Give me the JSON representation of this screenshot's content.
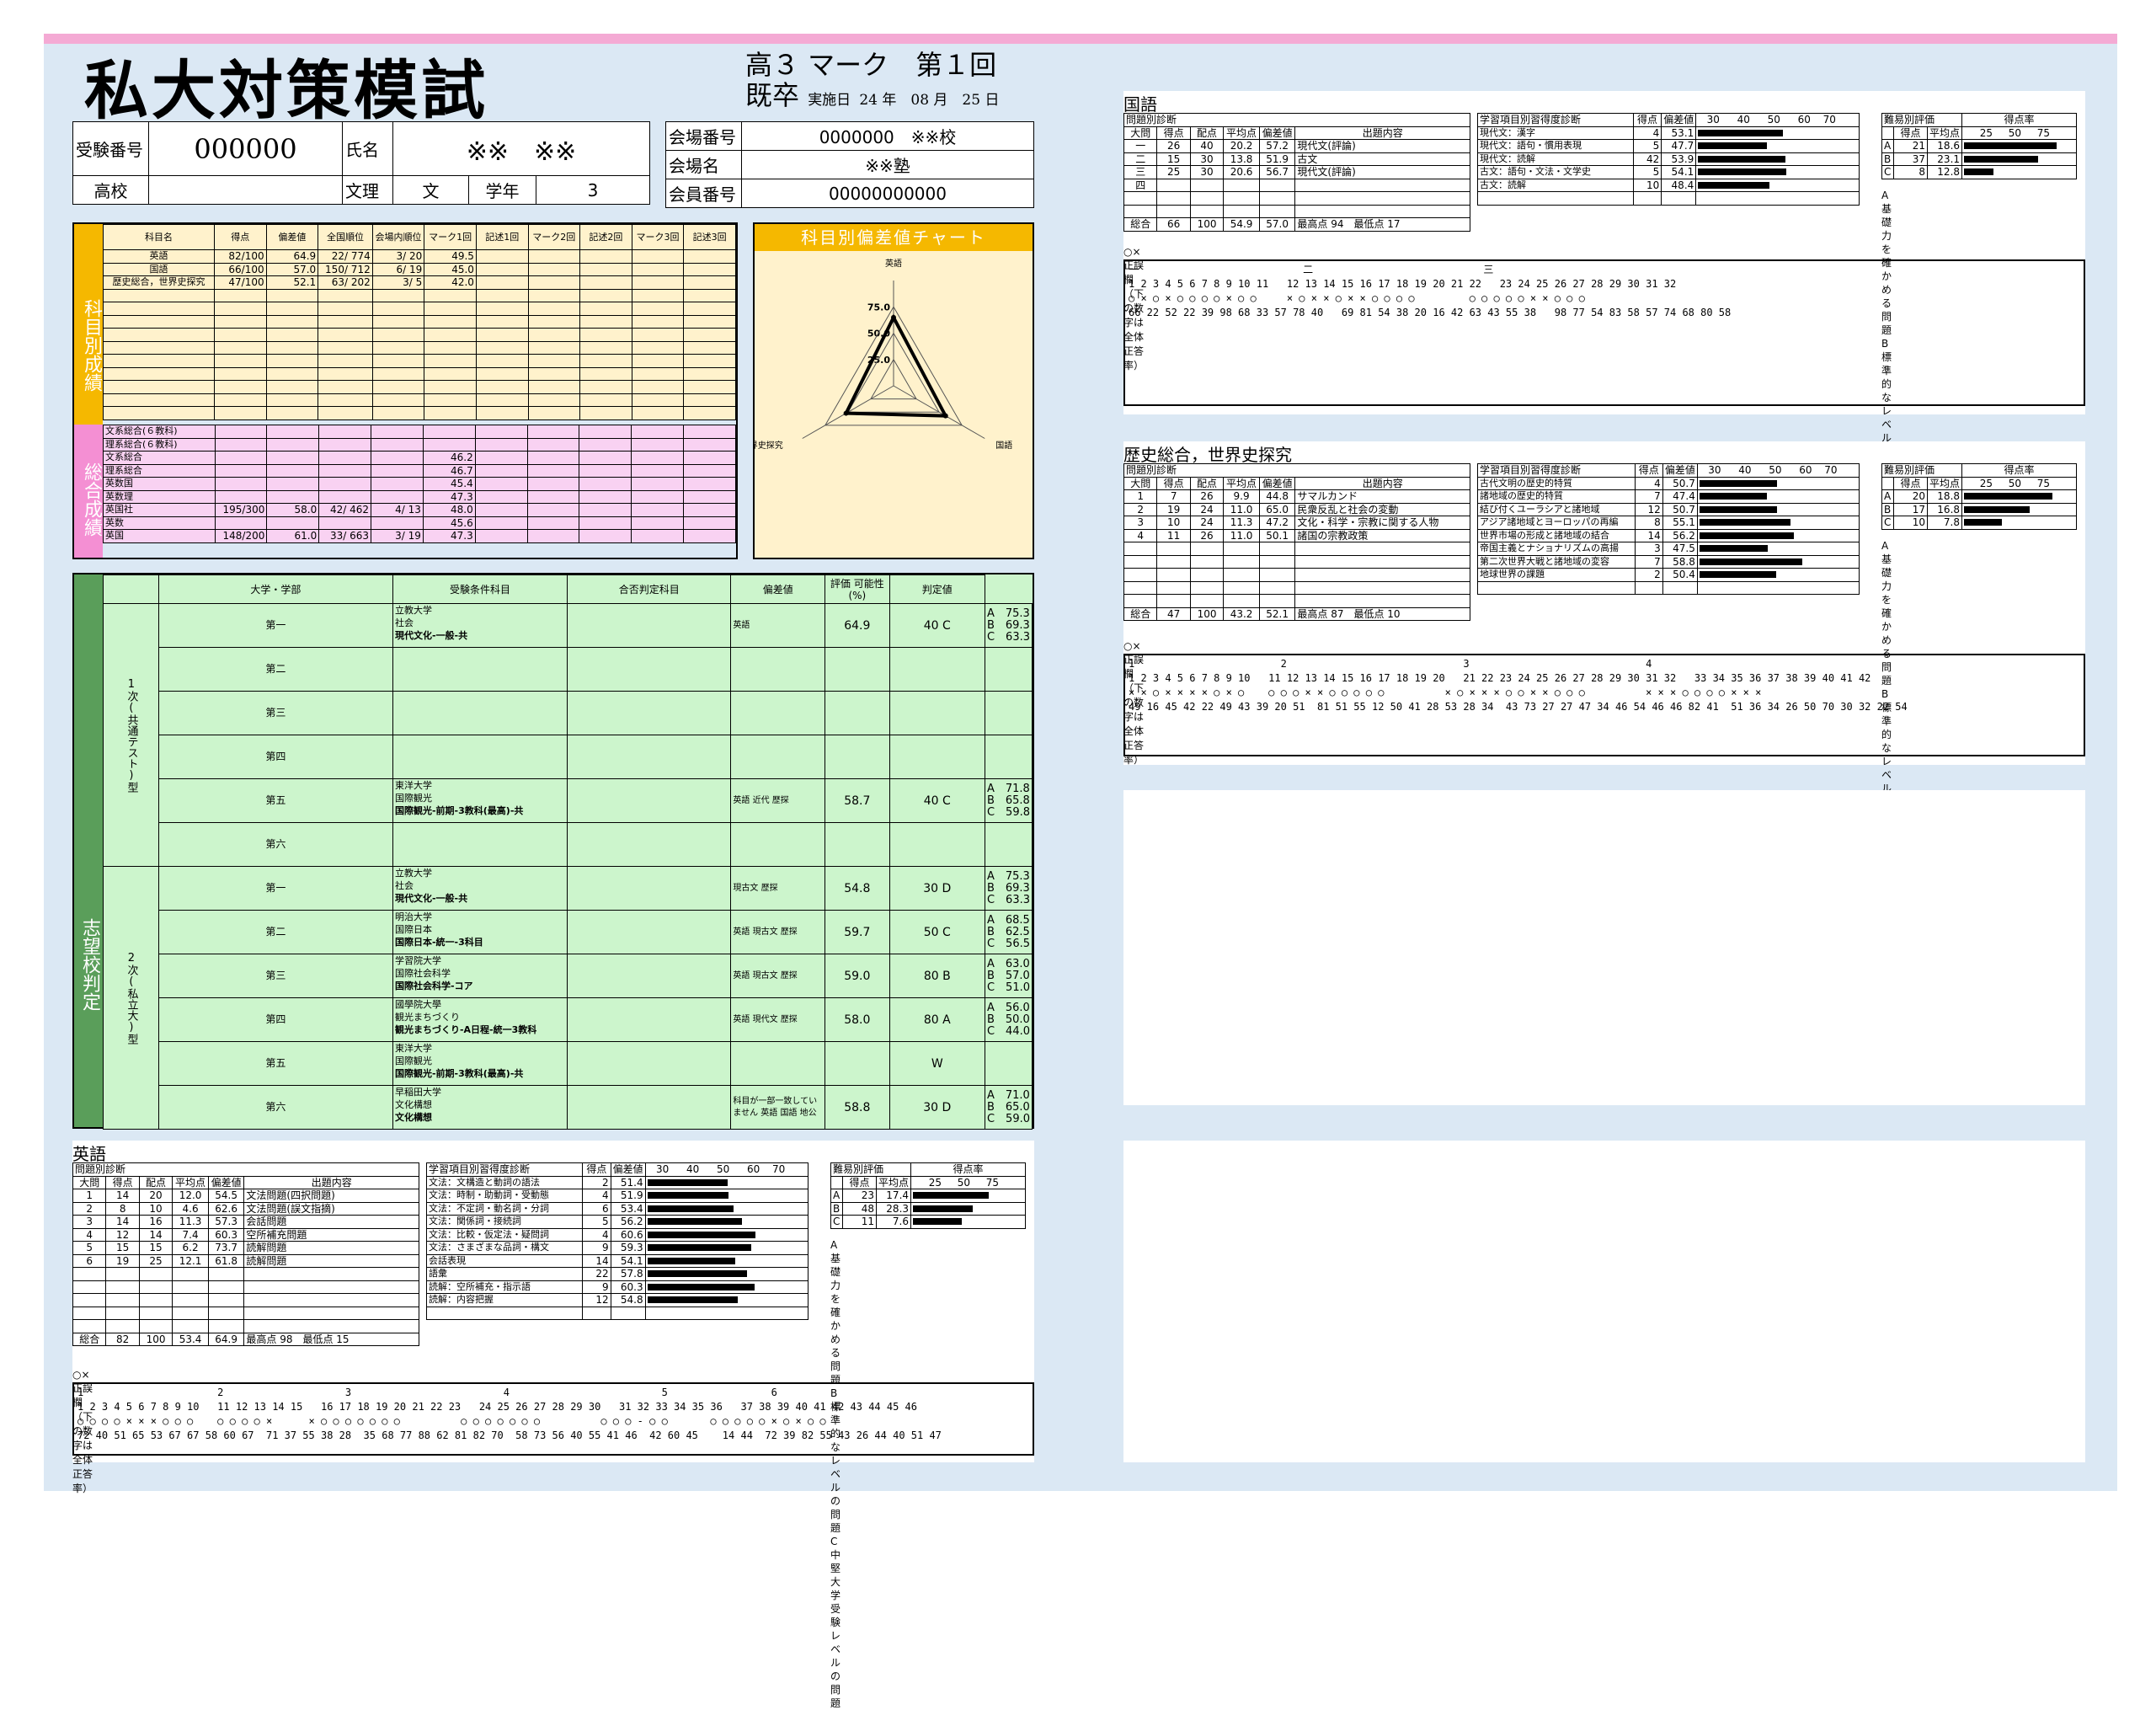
{
  "header": {
    "title": "私大対策模試",
    "exam_line": "高３ マーク　第１回",
    "grade": "既卒",
    "date_label": "実施日",
    "date": "24 年　08 月　25 日"
  },
  "info": {
    "exam_no_label": "受験番号",
    "exam_no": "000000",
    "name_label": "氏名",
    "name": "※※　※※",
    "school_label": "高校",
    "school": "",
    "bunri_label": "文理",
    "bunri": "文",
    "year_label": "学年",
    "year": "3",
    "venue_no_label": "会場番号",
    "venue_no": "0000000　※※校",
    "venue_label": "会場名",
    "venue": "※※塾",
    "member_label": "会員番号",
    "member": "00000000000"
  },
  "subjects": {
    "side_label": "科目別成績",
    "headers": [
      "科目名",
      "得点",
      "偏差値",
      "全国順位",
      "会場内順位",
      "マーク1回",
      "記述1回",
      "マーク2回",
      "記述2回",
      "マーク3回",
      "記述3回"
    ],
    "rows": [
      [
        "英語",
        "82/100",
        "64.9",
        "22/ 774",
        "3/ 20",
        "49.5"
      ],
      [
        "国語",
        "66/100",
        "57.0",
        "150/ 712",
        "6/ 19",
        "45.0"
      ],
      [
        "歴史総合，世界史探究",
        "47/100",
        "52.1",
        "63/ 202",
        "3/ 5",
        "42.0"
      ]
    ],
    "total_label": "総合成績",
    "total_rows": [
      [
        "文系総合(６教科)",
        "",
        "",
        "",
        "",
        ""
      ],
      [
        "理系総合(６教科)",
        "",
        "",
        "",
        "",
        ""
      ],
      [
        "文系総合",
        "",
        "",
        "",
        "",
        "46.2"
      ],
      [
        "理系総合",
        "",
        "",
        "",
        "",
        "46.7"
      ],
      [
        "英数国",
        "",
        "",
        "",
        "",
        "45.4"
      ],
      [
        "英数理",
        "",
        "",
        "",
        "",
        "47.3"
      ],
      [
        "英国社",
        "195/300",
        "58.0",
        "42/ 462",
        "4/ 13",
        "48.0"
      ],
      [
        "英数",
        "",
        "",
        "",
        "",
        "45.6"
      ],
      [
        "英国",
        "148/200",
        "61.0",
        "33/ 663",
        "3/ 19",
        "47.3"
      ]
    ]
  },
  "chart_data": {
    "type": "radar",
    "title": "科目別偏差値チャート",
    "axes": [
      "英語",
      "国語",
      "歴史総合，世界史探究"
    ],
    "ticks": [
      25.0,
      50.0,
      75.0
    ],
    "values": [
      64.9,
      57.0,
      52.1
    ]
  },
  "judge": {
    "side_label": "志望校判定",
    "headers": [
      "大学・学部",
      "受験条件科目",
      "合否判定科目",
      "偏差値",
      "評価 可能性(%)",
      "判定値"
    ],
    "first_label": "1次(共通テスト)型",
    "second_label": "2次(私立大)型",
    "first": [
      {
        "no": "第一",
        "univ": "立教大学",
        "fac": "社会",
        "course": "現代文化-一般-共",
        "cond": "",
        "subj": "英語",
        "dev": "64.9",
        "eval": "40 C",
        "lv": [
          "A　75.3",
          "B　69.3",
          "C　63.3"
        ]
      },
      {
        "no": "第二"
      },
      {
        "no": "第三"
      },
      {
        "no": "第四"
      },
      {
        "no": "第五",
        "univ": "東洋大学",
        "fac": "国際観光",
        "course": "国際観光-前期-3教科(最高)-共",
        "cond": "",
        "subj": "英語 近代 歴探",
        "dev": "58.7",
        "eval": "40 C",
        "lv": [
          "A　71.8",
          "B　65.8",
          "C　59.8"
        ]
      },
      {
        "no": "第六"
      }
    ],
    "second": [
      {
        "no": "第一",
        "univ": "立教大学",
        "fac": "社会",
        "course": "現代文化-一般-共",
        "cond": "",
        "subj": "現古文 歴探",
        "dev": "54.8",
        "eval": "30 D",
        "lv": [
          "A　75.3",
          "B　69.3",
          "C　63.3"
        ]
      },
      {
        "no": "第二",
        "univ": "明治大学",
        "fac": "国際日本",
        "course": "国際日本-統一-3科目",
        "cond": "",
        "subj": "英語 現古文 歴探",
        "dev": "59.7",
        "eval": "50 C",
        "lv": [
          "A　68.5",
          "B　62.5",
          "C　56.5"
        ]
      },
      {
        "no": "第三",
        "univ": "学習院大学",
        "fac": "国際社会科学",
        "course": "国際社会科学-コア",
        "cond": "",
        "subj": "英語 現古文 歴探",
        "dev": "59.0",
        "eval": "80 B",
        "lv": [
          "A　63.0",
          "B　57.0",
          "C　51.0"
        ]
      },
      {
        "no": "第四",
        "univ": "國學院大學",
        "fac": "観光まちづくり",
        "course": "観光まちづくり-A日程-統一3教科",
        "cond": "",
        "subj": "英語 現代文 歴探",
        "dev": "58.0",
        "eval": "80 A",
        "lv": [
          "A　56.0",
          "B　50.0",
          "C　44.0"
        ]
      },
      {
        "no": "第五",
        "univ": "東洋大学",
        "fac": "国際観光",
        "course": "国際観光-前期-3教科(最高)-共",
        "cond": "",
        "subj": "",
        "dev": "",
        "eval": "W",
        "lv": [
          "",
          "",
          ""
        ]
      },
      {
        "no": "第六",
        "univ": "早稲田大学",
        "fac": "文化構想",
        "course": "文化構想",
        "cond": "",
        "subj": "科目が一部一致していません 英語 国語 地公",
        "dev": "58.8",
        "eval": "30 D",
        "lv": [
          "A　71.0",
          "B　65.0",
          "C　59.0"
        ]
      }
    ]
  },
  "labels": {
    "q_diag": "問題別診断",
    "q_cols": [
      "大問",
      "得点",
      "配点",
      "平均点",
      "偏差値",
      "出題内容"
    ],
    "total": "総合",
    "max": "最高点",
    "min": "最低点",
    "item_diag": "学習項目別習得度診断",
    "item_cols": [
      "得点",
      "偏差値"
    ],
    "scale": [
      "30",
      "40",
      "50",
      "60",
      "70"
    ],
    "diff": "難易別評価",
    "rate": "得点率",
    "diff_cols": [
      "得点",
      "平均点"
    ],
    "rate_scale": [
      "25",
      "50",
      "75"
    ],
    "legend": [
      "A 基礎力を確かめる問題",
      "B 標準的なレベルの問題",
      "C 中堅大学受験レベルの問題"
    ],
    "ans_title": "○×正誤欄（下の数字は全体正答率）"
  },
  "sec_en": {
    "title": "英語",
    "q": [
      [
        "1",
        "14",
        "20",
        "12.0",
        "54.5",
        "文法問題(四択問題)"
      ],
      [
        "2",
        "8",
        "10",
        "4.6",
        "62.6",
        "文法問題(誤文指摘)"
      ],
      [
        "3",
        "14",
        "16",
        "11.3",
        "57.3",
        "会話問題"
      ],
      [
        "4",
        "12",
        "14",
        "7.4",
        "60.3",
        "空所補充問題"
      ],
      [
        "5",
        "15",
        "15",
        "6.2",
        "73.7",
        "読解問題"
      ],
      [
        "6",
        "19",
        "25",
        "12.1",
        "61.8",
        "読解問題"
      ]
    ],
    "sum": [
      "82",
      "100",
      "53.4",
      "64.9",
      "98",
      "15"
    ],
    "items": [
      [
        "文法：文構造と動詞の語法",
        "2",
        "51.4"
      ],
      [
        "文法：時制・助動詞・受動態",
        "4",
        "51.9"
      ],
      [
        "文法：不定詞・動名詞・分詞",
        "6",
        "53.4"
      ],
      [
        "文法：関係詞・接続詞",
        "5",
        "56.2"
      ],
      [
        "文法：比較・仮定法・疑問詞",
        "4",
        "60.6"
      ],
      [
        "文法：さまざまな品詞・構文",
        "9",
        "59.3"
      ],
      [
        "会話表現",
        "14",
        "54.1"
      ],
      [
        "語彙",
        "22",
        "57.8"
      ],
      [
        "読解：空所補充・指示語",
        "9",
        "60.3"
      ],
      [
        "読解：内容把握",
        "12",
        "54.8"
      ]
    ],
    "diff": [
      [
        "A",
        "23",
        "17.4",
        "72"
      ],
      [
        "B",
        "48",
        "28.3",
        "57"
      ],
      [
        "C",
        "11",
        "7.6",
        "46"
      ]
    ],
    "ans": [
      "1                      2                    3                         4                         5                 6",
      "1 2 3 4 5 6 7 8 9 10   11 12 13 14 15   16 17 18 19 20 21 22 23   24 25 26 27 28 29 30   31 32 33 34 35 36   37 38 39 40 41 42 43 44 45 46",
      "○ ○ ○ ○ × × × ○ ○ ○    ○ ○ ○ ○ ×      × ○ ○ ○ ○ ○ ○ ○          ○ ○ ○ ○ ○ ○ ○          ○ ○ ○ ‐ ○ ○       ○ ○ ○ ○ ○ × ○ × ○ ○",
      "72 40 51 65 53 67 67 58 60 67  71 37 55 38 28  35 68 77 88 62 81 82 70  58 73 56 40 55 41 46  42 60 45    14 44  72 39 82 55 43 26 44 40 51 47"
    ]
  },
  "sec_jp": {
    "title": "国語",
    "q": [
      [
        "一",
        "26",
        "40",
        "20.2",
        "57.2",
        "現代文(評論)"
      ],
      [
        "二",
        "15",
        "30",
        "13.8",
        "51.9",
        "古文"
      ],
      [
        "三",
        "25",
        "30",
        "20.6",
        "56.7",
        "現代文(評論)"
      ],
      [
        "四",
        "",
        "",
        "",
        "",
        ""
      ]
    ],
    "sum": [
      "66",
      "100",
      "54.9",
      "57.0",
      "94",
      "17"
    ],
    "items": [
      [
        "現代文：漢字",
        "4",
        "53.1"
      ],
      [
        "現代文：語句・慣用表現",
        "5",
        "47.7"
      ],
      [
        "現代文：読解",
        "42",
        "53.9"
      ],
      [
        "古文：語句・文法・文学史",
        "5",
        "54.1"
      ],
      [
        "古文：読解",
        "10",
        "48.4"
      ]
    ],
    "diff": [
      [
        "A",
        "21",
        "18.6",
        "88"
      ],
      [
        "B",
        "37",
        "23.1",
        "70"
      ],
      [
        "C",
        "8",
        "12.8",
        "28"
      ]
    ],
    "ans": [
      "一                           二                            三",
      "1 2 3 4 5 6 7 8 9 10 11   12 13 14 15 16 17 18 19 20 21 22   23 24 25 26 27 28 29 30 31 32",
      "○ × ○ × ○ ○ ○ ○ × ○ ○     × ○ × × ○ × × ○ ○ ○ ○         ○ ○ ○ ○ ○ × × ○ ○ ○",
      "66 22 52 22 39 98 68 33 57 78 40   69 81 54 38 20 16 42 63 43 55 38   98 77 54 83 58 57 74 68 80 58"
    ]
  },
  "sec_hist": {
    "title": "歴史総合，世界史探究",
    "q": [
      [
        "1",
        "7",
        "26",
        "9.9",
        "44.8",
        "サマルカンド"
      ],
      [
        "2",
        "19",
        "24",
        "11.0",
        "65.0",
        "民衆反乱と社会の変動"
      ],
      [
        "3",
        "10",
        "24",
        "11.3",
        "47.2",
        "文化・科学・宗教に関する人物"
      ],
      [
        "4",
        "11",
        "26",
        "11.0",
        "50.1",
        "諸国の宗教政策"
      ]
    ],
    "sum": [
      "47",
      "100",
      "43.2",
      "52.1",
      "87",
      "10"
    ],
    "items": [
      [
        "古代文明の歴史的特質",
        "4",
        "50.7"
      ],
      [
        "諸地域の歴史的特質",
        "7",
        "47.4"
      ],
      [
        "結び付くユーラシアと諸地域",
        "12",
        "50.7"
      ],
      [
        "アジア諸地域とヨーロッパの再編",
        "8",
        "55.1"
      ],
      [
        "世界市場の形成と諸地域の結合",
        "14",
        "56.2"
      ],
      [
        "帝国主義とナショナリズムの高揚",
        "3",
        "47.5"
      ],
      [
        "第二次世界大戦と諸地域の変容",
        "7",
        "58.8"
      ],
      [
        "地球世界の課題",
        "2",
        "50.4"
      ]
    ],
    "diff": [
      [
        "A",
        "20",
        "18.8",
        "84"
      ],
      [
        "B",
        "17",
        "16.8",
        "62"
      ],
      [
        "C",
        "10",
        "7.8",
        "36"
      ]
    ],
    "ans": [
      "1                        2                             3                             4",
      "1 2 3 4 5 6 7 8 9 10   11 12 13 14 15 16 17 18 19 20   21 22 23 24 25 26 27 28 29 30 31 32   33 34 35 36 37 38 39 40 41 42",
      "× × ○ × × × × ○ × ○    ○ ○ ○ × × ○ ○ ○ ○ ○          × ○ × × × ○ ○ × × ○ ○ ○          × × × ○ ○ ○ ○ × × ×",
      "49 16 45 42 22 49 43 39 20 51  81 51 55 12 50 41 28 53 28 34  43 73 27 27 47 34 46 54 46 46 82 41  51 36 34 26 50 70 30 32 22 54"
    ]
  }
}
